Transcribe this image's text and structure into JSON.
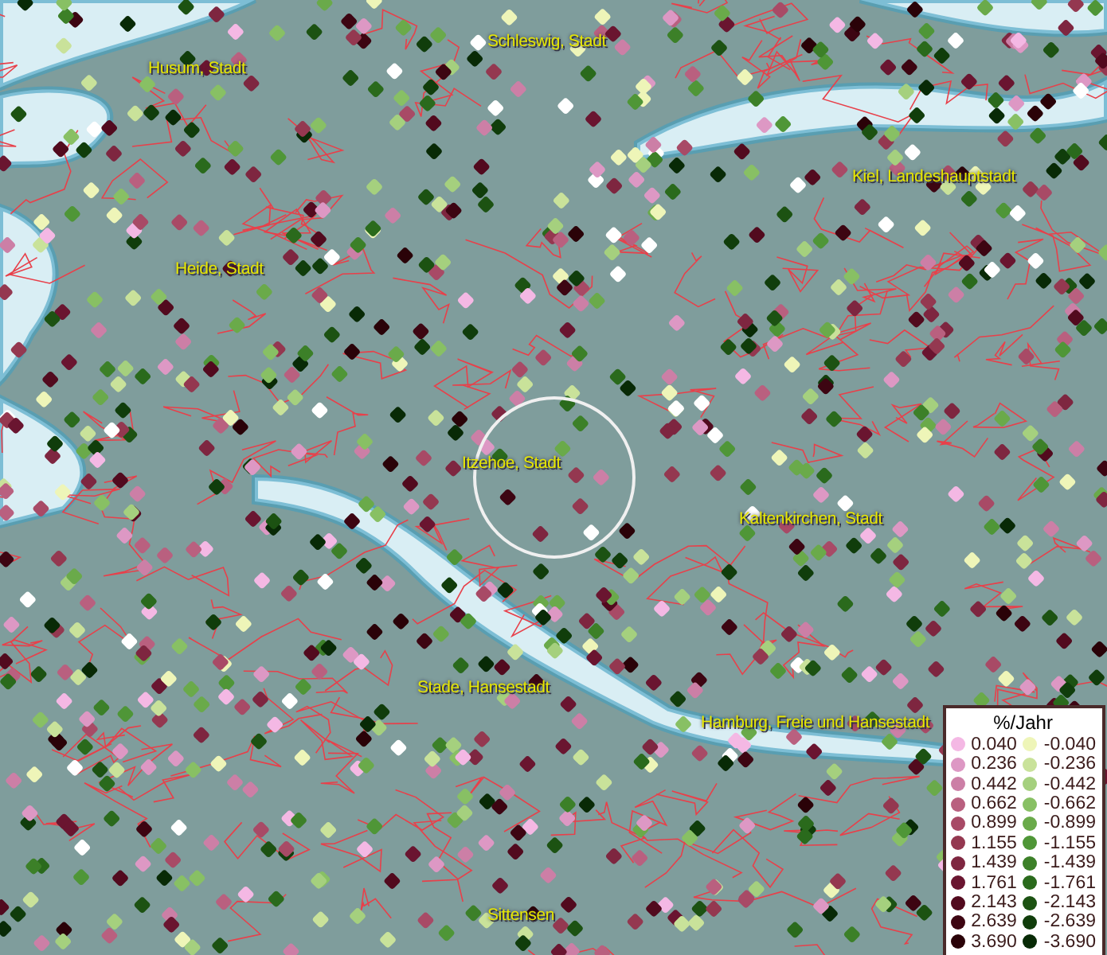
{
  "map": {
    "places": [
      {
        "name": "Husum, Stadt"
      },
      {
        "name": "Schleswig, Stadt"
      },
      {
        "name": "Kiel, Landeshauptstadt"
      },
      {
        "name": "Heide, Stadt"
      },
      {
        "name": "Itzehoe, Stadt"
      },
      {
        "name": "Kaltenkirchen, Stadt"
      },
      {
        "name": "Stade, Hansestadt"
      },
      {
        "name": "Hamburg, Freie und Hansestadt"
      },
      {
        "name": "Sittensen"
      }
    ]
  },
  "legend": {
    "title": "%/Jahr",
    "positive": [
      {
        "label": "0.040",
        "color": "#f4b8e4"
      },
      {
        "label": "0.236",
        "color": "#dd98c4"
      },
      {
        "label": "0.442",
        "color": "#cc7fa6"
      },
      {
        "label": "0.662",
        "color": "#b9607f"
      },
      {
        "label": "0.899",
        "color": "#a84a66"
      },
      {
        "label": "1.155",
        "color": "#943850"
      },
      {
        "label": "1.439",
        "color": "#7e2640"
      },
      {
        "label": "1.761",
        "color": "#6a1530"
      },
      {
        "label": "2.143",
        "color": "#520a1e"
      },
      {
        "label": "2.639",
        "color": "#3d0512"
      },
      {
        "label": "3.690",
        "color": "#2a0208"
      }
    ],
    "negative": [
      {
        "label": "-0.040",
        "color": "#eef5b8"
      },
      {
        "label": "-0.236",
        "color": "#c9e29a"
      },
      {
        "label": "-0.442",
        "color": "#a5d07e"
      },
      {
        "label": "-0.662",
        "color": "#88c064"
      },
      {
        "label": "-0.899",
        "color": "#6aaa4a"
      },
      {
        "label": "-1.155",
        "color": "#4f9637"
      },
      {
        "label": "-1.439",
        "color": "#3c8028"
      },
      {
        "label": "-1.761",
        "color": "#2a6a1c"
      },
      {
        "label": "-2.143",
        "color": "#1c5212"
      },
      {
        "label": "-2.639",
        "color": "#103d0b"
      },
      {
        "label": "-3.690",
        "color": "#082a06"
      }
    ]
  }
}
